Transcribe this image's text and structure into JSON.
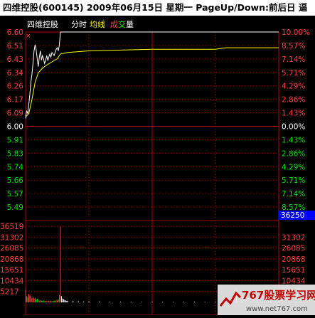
{
  "title": "四维控股(600145) 2009年06月15日 星期一 PageUp/Down:前后日 逼",
  "legend": {
    "name": "四维控股",
    "fenshi": "分时",
    "junxian": "均线",
    "cheng": "成",
    "jiao": "交",
    "liang": "量"
  },
  "colors": {
    "background": "#000000",
    "grid_red": "#b40000",
    "price_line": "#ffffff",
    "avg_line": "#ffff00",
    "up": "#ff3c3c",
    "flat": "#ffffff",
    "down": "#00e000",
    "highlight": "#0000ff"
  },
  "cursor_label": "36250",
  "watermark": {
    "brand": "767股票学习网",
    "url": "www.net767.com"
  },
  "chart_data": {
    "type": "line",
    "prev_close": 6.0,
    "price_axis_ticks": [
      "6.60",
      "6.51",
      "6.43",
      "6.34",
      "6.26",
      "6.17",
      "6.09",
      "6.00",
      "5.91",
      "5.83",
      "5.74",
      "5.66",
      "5.57",
      "5.49"
    ],
    "pct_axis_ticks": [
      "10.00%",
      "8.57%",
      "7.14%",
      "5.71%",
      "4.29%",
      "2.86%",
      "1.43%",
      "0.00%",
      "1.43%",
      "2.86%",
      "4.29%",
      "5.71%",
      "7.14%",
      "8.57%"
    ],
    "volume_axis_ticks": [
      "36519",
      "31302",
      "26085",
      "20868",
      "15651",
      "10434",
      "5217"
    ],
    "price_series": [
      [
        0,
        6.05
      ],
      [
        1,
        6.1
      ],
      [
        2,
        6.08
      ],
      [
        3,
        6.14
      ],
      [
        4,
        6.2
      ],
      [
        5,
        6.28
      ],
      [
        6,
        6.33
      ],
      [
        7,
        6.4
      ],
      [
        8,
        6.48
      ],
      [
        9,
        6.52
      ],
      [
        10,
        6.49
      ],
      [
        11,
        6.43
      ],
      [
        12,
        6.38
      ],
      [
        13,
        6.44
      ],
      [
        14,
        6.48
      ],
      [
        15,
        6.42
      ],
      [
        16,
        6.45
      ],
      [
        17,
        6.43
      ],
      [
        18,
        6.4
      ],
      [
        19,
        6.42
      ],
      [
        20,
        6.45
      ],
      [
        21,
        6.42
      ],
      [
        22,
        6.44
      ],
      [
        23,
        6.46
      ],
      [
        24,
        6.44
      ],
      [
        25,
        6.47
      ],
      [
        26,
        6.46
      ],
      [
        27,
        6.45
      ],
      [
        28,
        6.47
      ],
      [
        29,
        6.49
      ],
      [
        30,
        6.5
      ],
      [
        31,
        6.48
      ],
      [
        32,
        6.52
      ],
      [
        33,
        6.6
      ],
      [
        60,
        6.6
      ],
      [
        120,
        6.6
      ],
      [
        180,
        6.6
      ],
      [
        240,
        6.6
      ]
    ],
    "avg_series": [
      [
        0,
        6.06
      ],
      [
        3,
        6.08
      ],
      [
        6,
        6.17
      ],
      [
        9,
        6.28
      ],
      [
        12,
        6.34
      ],
      [
        16,
        6.37
      ],
      [
        20,
        6.39
      ],
      [
        25,
        6.41
      ],
      [
        30,
        6.43
      ],
      [
        33,
        6.46
      ],
      [
        40,
        6.47
      ],
      [
        60,
        6.48
      ],
      [
        90,
        6.485
      ],
      [
        120,
        6.49
      ],
      [
        150,
        6.49
      ],
      [
        180,
        6.49
      ],
      [
        190,
        6.5
      ],
      [
        200,
        6.5
      ],
      [
        220,
        6.5
      ],
      [
        240,
        6.5
      ]
    ],
    "volume_series": [
      [
        0,
        6000
      ],
      [
        1,
        3000
      ],
      [
        2,
        2500
      ],
      [
        3,
        4000
      ],
      [
        4,
        3500
      ],
      [
        5,
        3000
      ],
      [
        6,
        2000
      ],
      [
        7,
        2500
      ],
      [
        8,
        1800
      ],
      [
        9,
        2200
      ],
      [
        10,
        1500
      ],
      [
        11,
        1700
      ],
      [
        12,
        1200
      ],
      [
        13,
        900
      ],
      [
        14,
        1100
      ],
      [
        15,
        800
      ],
      [
        16,
        700
      ],
      [
        17,
        900
      ],
      [
        18,
        600
      ],
      [
        19,
        700
      ],
      [
        20,
        500
      ],
      [
        21,
        600
      ],
      [
        22,
        700
      ],
      [
        23,
        500
      ],
      [
        24,
        800
      ],
      [
        25,
        600
      ],
      [
        26,
        500
      ],
      [
        27,
        900
      ],
      [
        28,
        700
      ],
      [
        29,
        1200
      ],
      [
        30,
        900
      ],
      [
        31,
        1500
      ],
      [
        32,
        3500
      ],
      [
        33,
        36250
      ],
      [
        34,
        3000
      ],
      [
        35,
        1800
      ],
      [
        36,
        1500
      ],
      [
        37,
        1200
      ],
      [
        38,
        900
      ],
      [
        39,
        700
      ],
      [
        40,
        800
      ],
      [
        45,
        600
      ],
      [
        50,
        500
      ],
      [
        55,
        400
      ],
      [
        60,
        500
      ],
      [
        70,
        400
      ],
      [
        80,
        300
      ],
      [
        90,
        350
      ],
      [
        100,
        300
      ],
      [
        110,
        250
      ],
      [
        120,
        300
      ],
      [
        130,
        250
      ],
      [
        140,
        200
      ],
      [
        150,
        250
      ],
      [
        160,
        300
      ],
      [
        170,
        250
      ],
      [
        180,
        300
      ],
      [
        190,
        400
      ],
      [
        200,
        6000
      ],
      [
        205,
        500
      ],
      [
        210,
        400
      ],
      [
        220,
        300
      ],
      [
        230,
        350
      ],
      [
        240,
        300
      ]
    ],
    "ylim_price": [
      5.4,
      6.6
    ],
    "ylim_volume": [
      0,
      36519
    ],
    "xlim_minutes": [
      0,
      240
    ],
    "grid": true
  }
}
